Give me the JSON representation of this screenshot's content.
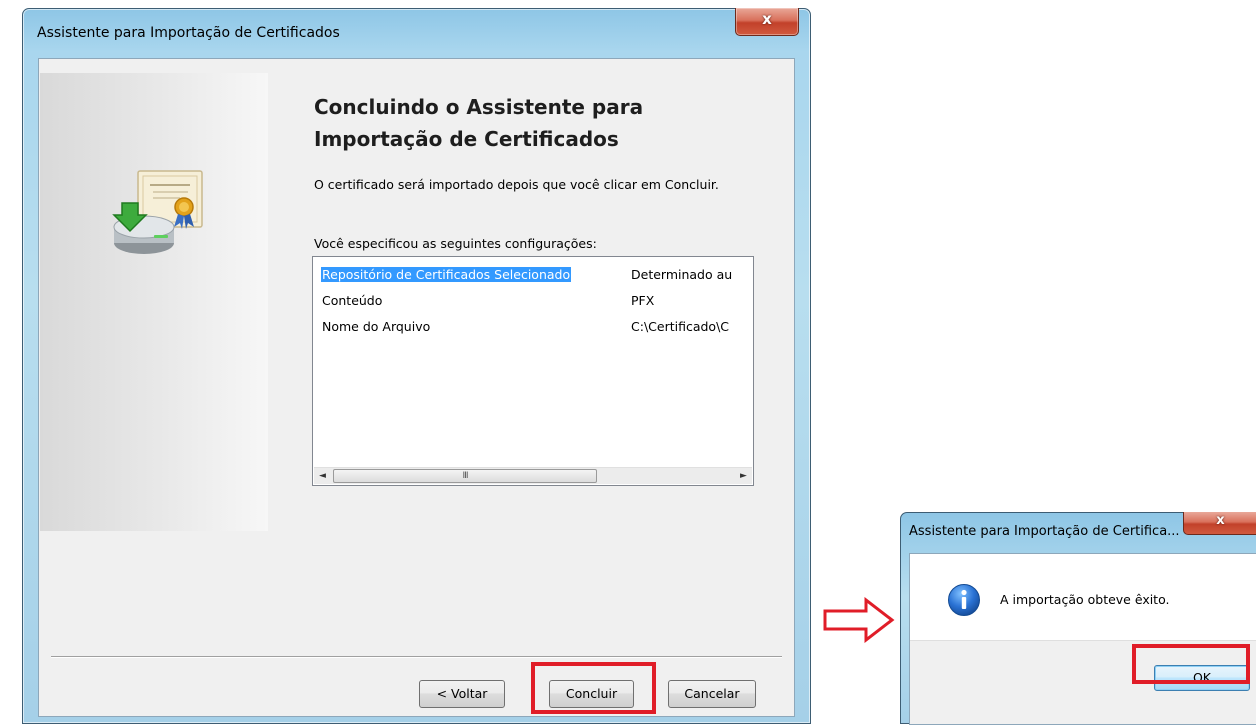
{
  "wizard": {
    "title": "Assistente para Importação de Certificados",
    "close_glyph": "x",
    "heading_line1": "Concluindo o Assistente para",
    "heading_line2": "Importação de Certificados",
    "description": "O certificado será importado depois que você clicar em Concluir.",
    "settings_label": "Você especificou as seguintes configurações:",
    "settings": [
      {
        "name": "Repositório de Certificados Selecionado",
        "value": "Determinado au"
      },
      {
        "name": "Conteúdo",
        "value": "PFX"
      },
      {
        "name": "Nome do Arquivo",
        "value": "C:\\Certificado\\C"
      }
    ],
    "scroll_left": "◄",
    "scroll_right": "►",
    "scroll_grip": "III",
    "buttons": {
      "back": "< Voltar",
      "finish": "Concluir",
      "cancel": "Cancelar"
    },
    "icon": "certificate-import-icon"
  },
  "success_dialog": {
    "title": "Assistente para Importação de Certifica...",
    "close_glyph": "x",
    "message": "A importação obteve êxito.",
    "ok": "OK",
    "icon": "info-icon"
  },
  "colors": {
    "highlight": "#e01d28",
    "selection": "#3399ff",
    "arrow": "#e01d28"
  }
}
